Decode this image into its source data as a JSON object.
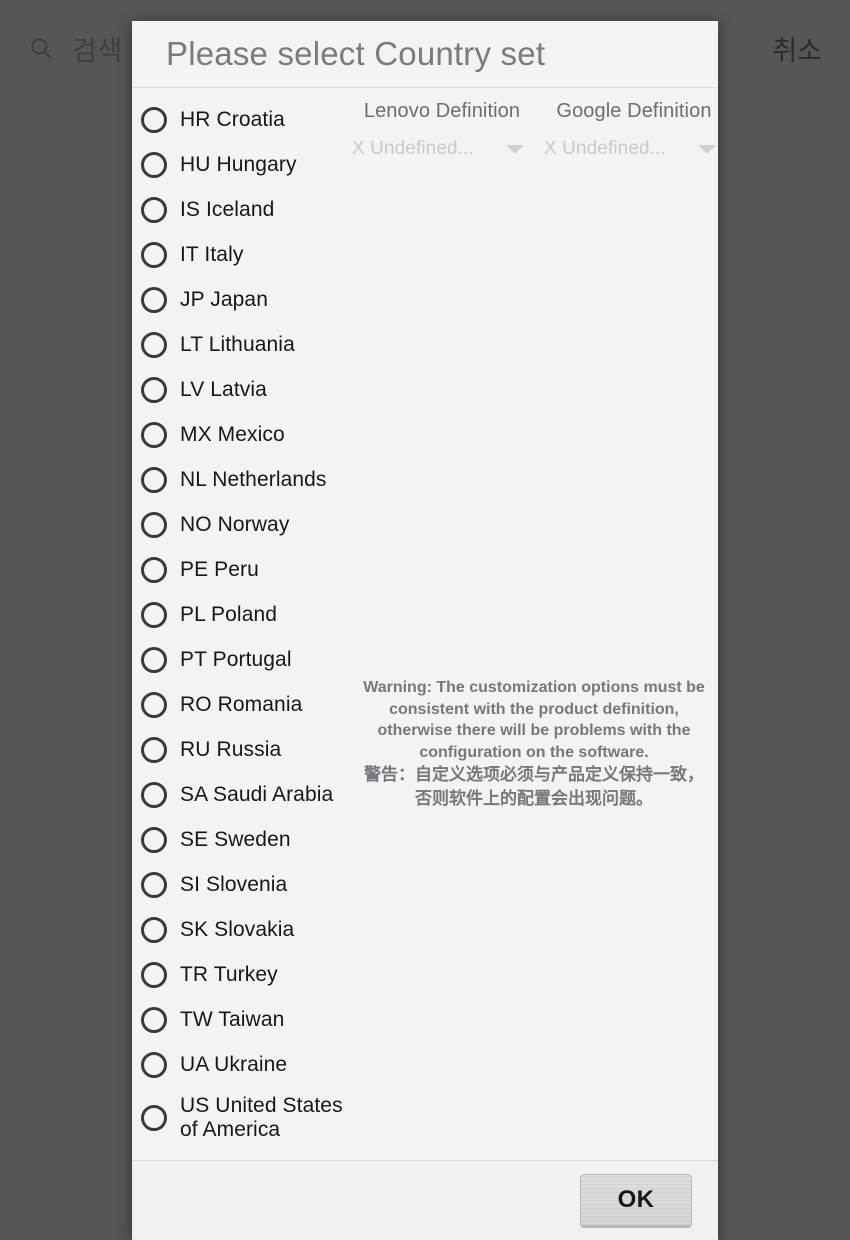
{
  "background": {
    "search_icon": "search-icon",
    "search_placeholder": "검색",
    "cancel_label": "취소"
  },
  "dialog": {
    "title": "Please select Country set",
    "countries": [
      {
        "code": "HR",
        "name": "Croatia",
        "label": "HR Croatia"
      },
      {
        "code": "HU",
        "name": "Hungary",
        "label": "HU Hungary"
      },
      {
        "code": "IS",
        "name": "Iceland",
        "label": "IS Iceland"
      },
      {
        "code": "IT",
        "name": "Italy",
        "label": "IT Italy"
      },
      {
        "code": "JP",
        "name": "Japan",
        "label": "JP Japan"
      },
      {
        "code": "LT",
        "name": "Lithuania",
        "label": "LT Lithuania"
      },
      {
        "code": "LV",
        "name": "Latvia",
        "label": "LV Latvia"
      },
      {
        "code": "MX",
        "name": "Mexico",
        "label": "MX Mexico"
      },
      {
        "code": "NL",
        "name": "Netherlands",
        "label": "NL Netherlands"
      },
      {
        "code": "NO",
        "name": "Norway",
        "label": "NO Norway"
      },
      {
        "code": "PE",
        "name": "Peru",
        "label": "PE Peru"
      },
      {
        "code": "PL",
        "name": "Poland",
        "label": "PL Poland"
      },
      {
        "code": "PT",
        "name": "Portugal",
        "label": "PT Portugal"
      },
      {
        "code": "RO",
        "name": "Romania",
        "label": "RO Romania"
      },
      {
        "code": "RU",
        "name": "Russia",
        "label": "RU Russia"
      },
      {
        "code": "SA",
        "name": "Saudi Arabia",
        "label": "SA Saudi Arabia"
      },
      {
        "code": "SE",
        "name": "Sweden",
        "label": "SE Sweden"
      },
      {
        "code": "SI",
        "name": "Slovenia",
        "label": "SI Slovenia"
      },
      {
        "code": "SK",
        "name": "Slovakia",
        "label": "SK Slovakia"
      },
      {
        "code": "TR",
        "name": "Turkey",
        "label": "TR Turkey"
      },
      {
        "code": "TW",
        "name": "Taiwan",
        "label": "TW Taiwan"
      },
      {
        "code": "UA",
        "name": "Ukraine",
        "label": "UA Ukraine"
      },
      {
        "code": "US",
        "name": "United States of America",
        "label": "US United States of America"
      }
    ],
    "selected_country": null,
    "definitions": [
      {
        "title": "Lenovo Definition",
        "value": "X Undefined...",
        "caret": "chevron-down-icon"
      },
      {
        "title": "Google Definition",
        "value": "X Undefined...",
        "caret": "chevron-down-icon"
      }
    ],
    "warning": {
      "en": "Warning: The customization options must be consistent with the product definition, otherwise there will be problems with the configuration on the software.",
      "cn": "警告：自定义选项必须与产品定义保持一致，否则软件上的配置会出现问题。"
    },
    "footer": {
      "ok_label": "OK"
    }
  },
  "colors": {
    "dialog_background": "#f3f2f5",
    "title_text": "#7a7a80",
    "list_text": "#17171a",
    "radio_stroke": "#3a3a3e",
    "definition_title": "#6d6d73",
    "definition_value": "#c9c8ce",
    "warning_text": "#77777d",
    "scrim": "#6e6e6e",
    "ok_button": "#d9d8dd"
  }
}
